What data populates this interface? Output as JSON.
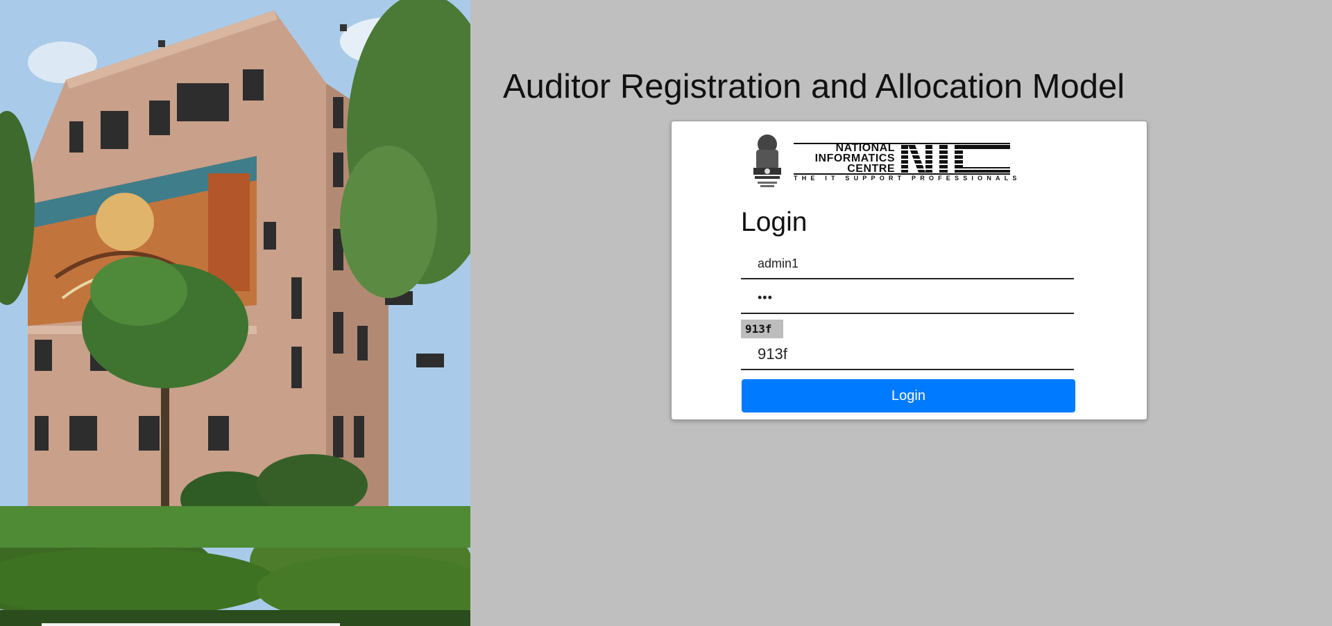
{
  "header": {
    "title": "Auditor Registration and Allocation Model"
  },
  "background": {
    "photo_subject": "national-informatics-centre-building"
  },
  "card": {
    "logo": {
      "emblem_icon": "national-emblem-icon",
      "org_name_line1": "NATIONAL",
      "org_name_line2": "INFORMATICS",
      "org_name_line3": "CENTRE",
      "tagline": "THE IT SUPPORT PROFESSIONALS",
      "wordmark": "NIC"
    },
    "heading": "Login",
    "username": {
      "value": "admin1"
    },
    "password": {
      "value": "•••"
    },
    "captcha": {
      "image_text": "913f",
      "value": "913f"
    },
    "login_button_label": "Login"
  },
  "colors": {
    "page_background": "#bfbfbf",
    "button": "#007bff",
    "card": "#ffffff"
  }
}
